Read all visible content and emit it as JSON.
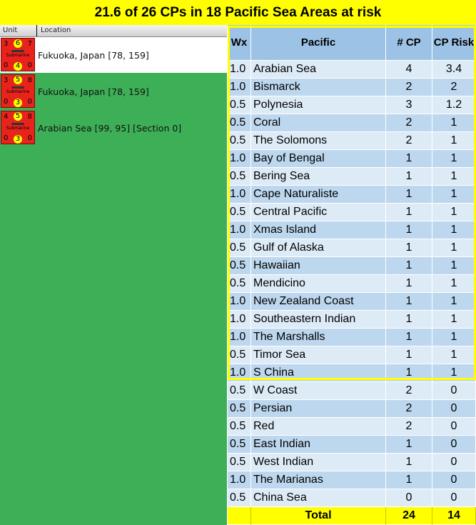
{
  "title": "21.6 of 26 CPs in 18 Pacific Sea Areas at risk",
  "unit_list": {
    "columns": [
      "Unit",
      "Location"
    ],
    "units": [
      {
        "tl": "3",
        "top": "6",
        "tr": "7",
        "bl": "0",
        "bottom": "4",
        "br": "0",
        "type": "Submarine",
        "location": "Fukuoka, Japan [78, 159]"
      },
      {
        "tl": "3",
        "top": "5",
        "tr": "8",
        "bl": "0",
        "bottom": "3",
        "br": "0",
        "type": "Submarine",
        "location": "Fukuoka, Japan [78, 159]"
      },
      {
        "tl": "4",
        "top": "5",
        "tr": "8",
        "bl": "0",
        "bottom": "3",
        "br": "0",
        "type": "Submarine",
        "location": "Arabian Sea [99, 95] [Section 0]"
      }
    ]
  },
  "table": {
    "headers": [
      "Wx",
      "Pacific",
      "# CP",
      "CP Risk"
    ],
    "rows": [
      [
        "1.0",
        "Arabian Sea",
        "4",
        "3.4"
      ],
      [
        "1.0",
        "Bismarck",
        "2",
        "2"
      ],
      [
        "0.5",
        "Polynesia",
        "3",
        "1.2"
      ],
      [
        "0.5",
        "Coral",
        "2",
        "1"
      ],
      [
        "0.5",
        "The Solomons",
        "2",
        "1"
      ],
      [
        "1.0",
        "Bay of Bengal",
        "1",
        "1"
      ],
      [
        "0.5",
        "Bering Sea",
        "1",
        "1"
      ],
      [
        "1.0",
        "Cape Naturaliste",
        "1",
        "1"
      ],
      [
        "0.5",
        "Central Pacific",
        "1",
        "1"
      ],
      [
        "1.0",
        "Xmas Island",
        "1",
        "1"
      ],
      [
        "0.5",
        "Gulf of Alaska",
        "1",
        "1"
      ],
      [
        "0.5",
        "Hawaiian",
        "1",
        "1"
      ],
      [
        "0.5",
        "Mendicino",
        "1",
        "1"
      ],
      [
        "1.0",
        "New Zealand Coast",
        "1",
        "1"
      ],
      [
        "1.0",
        "Southeastern Indian",
        "1",
        "1"
      ],
      [
        "1.0",
        "The Marshalls",
        "1",
        "1"
      ],
      [
        "0.5",
        "Timor Sea",
        "1",
        "1"
      ],
      [
        "1.0",
        "S China",
        "1",
        "1"
      ],
      [
        "0.5",
        "W Coast",
        "2",
        "0"
      ],
      [
        "0.5",
        "Persian",
        "2",
        "0"
      ],
      [
        "0.5",
        "Red",
        "2",
        "0"
      ],
      [
        "0.5",
        "East Indian",
        "1",
        "0"
      ],
      [
        "0.5",
        "West Indian",
        "1",
        "0"
      ],
      [
        "1.0",
        "The Marianas",
        "1",
        "0"
      ],
      [
        "0.5",
        "China Sea",
        "0",
        "0"
      ]
    ],
    "total": {
      "label": "Total",
      "cp": "24",
      "risk": "14"
    }
  },
  "colors": {
    "title_bg": "#ffff00",
    "left_bg": "#3daf57",
    "header_bg": "#9cc3e5",
    "row_light": "#ddebf7",
    "row_dark": "#bdd7ee",
    "counter": "#e8231c"
  }
}
